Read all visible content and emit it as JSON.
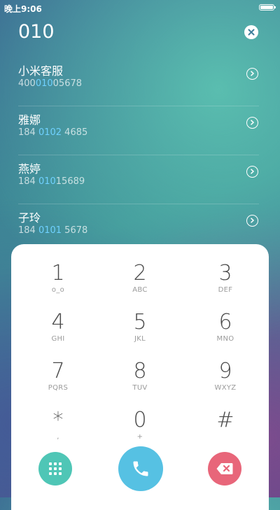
{
  "status_bar": {
    "time": "晚上9:06",
    "battery_level": 1.0
  },
  "dialer": {
    "number": "010"
  },
  "contacts": [
    {
      "name": "小米客服",
      "number_pre": "400",
      "number_match": "010",
      "number_post": "05678"
    },
    {
      "name": "雅娜",
      "number_pre": "184 ",
      "number_match": "0102",
      "number_post": " 4685"
    },
    {
      "name": "燕婷",
      "number_pre": "184 ",
      "number_match": "010",
      "number_post": "15689"
    },
    {
      "name": "子玲",
      "number_pre": "184 ",
      "number_match": "0101",
      "number_post": " 5678"
    }
  ],
  "keypad": {
    "keys": [
      {
        "digit": "1",
        "letters": "o_o"
      },
      {
        "digit": "2",
        "letters": "ABC"
      },
      {
        "digit": "3",
        "letters": "DEF"
      },
      {
        "digit": "4",
        "letters": "GHI"
      },
      {
        "digit": "5",
        "letters": "JKL"
      },
      {
        "digit": "6",
        "letters": "MNO"
      },
      {
        "digit": "7",
        "letters": "PQRS"
      },
      {
        "digit": "8",
        "letters": "TUV"
      },
      {
        "digit": "9",
        "letters": "WXYZ"
      },
      {
        "digit": "*",
        "letters": ","
      },
      {
        "digit": "0",
        "letters": "+"
      },
      {
        "digit": "#",
        "letters": ""
      }
    ]
  },
  "actions": {
    "keypad_toggle_color": "#4fc6b6",
    "call_color": "#56c1e3",
    "delete_color": "#e8667a"
  }
}
